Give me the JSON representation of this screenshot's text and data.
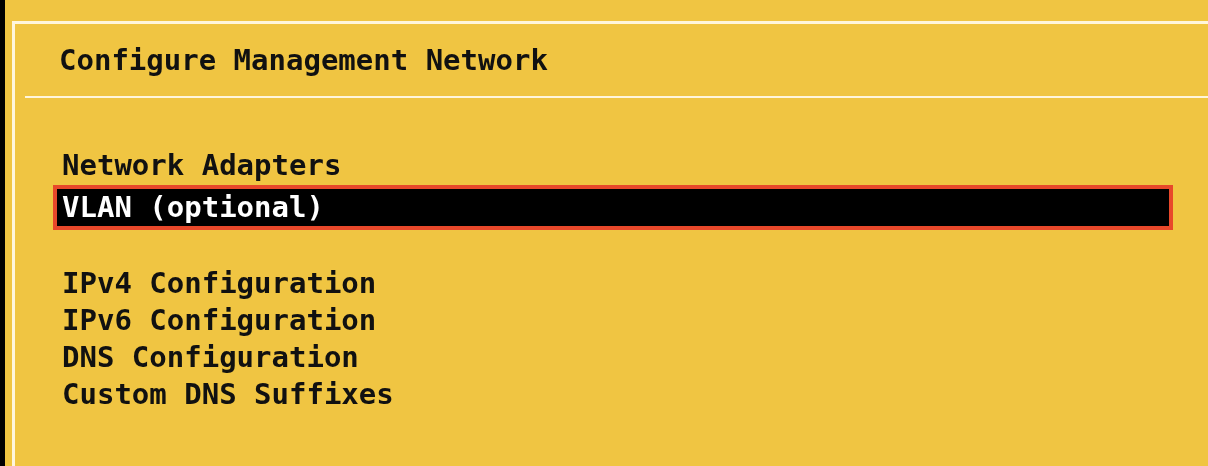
{
  "title": "Configure Management Network",
  "menu_groups": [
    {
      "items": [
        {
          "label": "Network Adapters",
          "selected": false
        },
        {
          "label": "VLAN (optional)",
          "selected": true
        }
      ]
    },
    {
      "items": [
        {
          "label": "IPv4 Configuration",
          "selected": false
        },
        {
          "label": "IPv6 Configuration",
          "selected": false
        },
        {
          "label": "DNS Configuration",
          "selected": false
        },
        {
          "label": "Custom DNS Suffixes",
          "selected": false
        }
      ]
    }
  ]
}
